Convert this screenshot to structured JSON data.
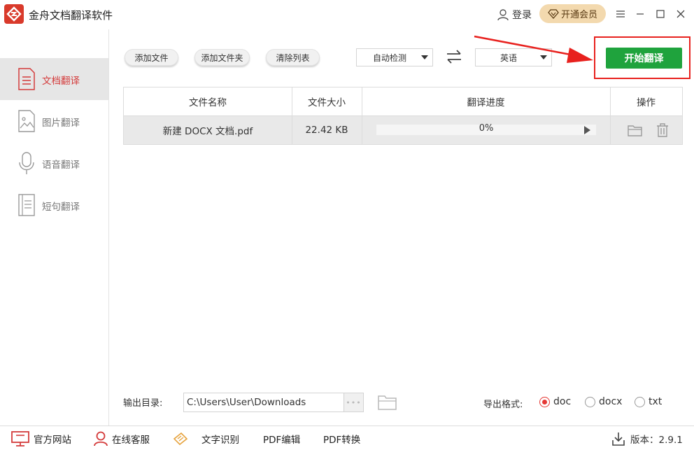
{
  "window": {
    "title": "金舟文档翻译软件",
    "login_label": "登录",
    "vip_label": "开通会员"
  },
  "sidebar": {
    "items": [
      {
        "label": "文档翻译",
        "icon": "document-icon",
        "active": true
      },
      {
        "label": "图片翻译",
        "icon": "image-icon",
        "active": false
      },
      {
        "label": "语音翻译",
        "icon": "microphone-icon",
        "active": false
      },
      {
        "label": "短句翻译",
        "icon": "text-icon",
        "active": false
      }
    ]
  },
  "toolbar": {
    "add_file_label": "添加文件",
    "add_folder_label": "添加文件夹",
    "clear_list_label": "清除列表",
    "source_lang": "自动检测",
    "target_lang": "英语",
    "start_label": "开始翻译"
  },
  "table": {
    "headers": [
      "文件名称",
      "文件大小",
      "翻译进度",
      "操作"
    ],
    "rows": [
      {
        "name": "新建 DOCX 文档.pdf",
        "size": "22.42 KB",
        "progress_text": "0%",
        "progress": 0
      }
    ]
  },
  "output": {
    "label": "输出目录:",
    "path": "C:\\Users\\User\\Downloads",
    "more_label": "•••",
    "format_label": "导出格式:",
    "formats": [
      {
        "label": "doc",
        "checked": true
      },
      {
        "label": "docx",
        "checked": false
      },
      {
        "label": "txt",
        "checked": false
      }
    ]
  },
  "footer": {
    "website": "官方网站",
    "support": "在线客服",
    "ocr": "文字识别",
    "pdf_edit": "PDF编辑",
    "pdf_convert": "PDF转换",
    "version": "版本：2.9.1"
  },
  "colors": {
    "accent_red": "#d43b3b",
    "start_green": "#1fa33d",
    "highlight_red": "#e8211e",
    "vip_gold": "#f3d9ae"
  }
}
